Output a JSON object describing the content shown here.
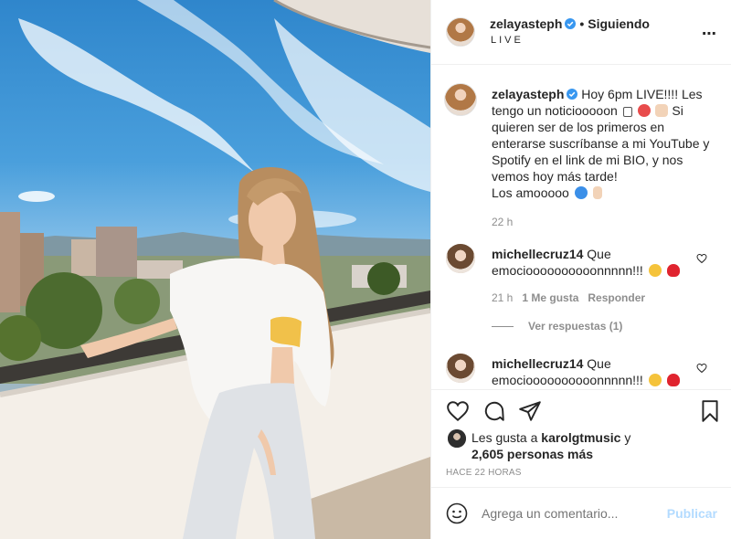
{
  "header": {
    "username": "zelayasteph",
    "separator": "•",
    "follow_status": "Siguiendo",
    "location": "LIVE",
    "more_icon": "⋯"
  },
  "caption": {
    "username": "zelayasteph",
    "text_lines": [
      "Hoy 6pm LIVE!!!! Les",
      "tengo un noticiooooon",
      "Si",
      "quieren ser de los primeros en",
      "enterarse suscríbanse a mi YouTube y",
      "Spotify en el link de mi BIO, y nos",
      "vemos hoy más tarde!",
      "Los amooooo"
    ],
    "time": "22 h"
  },
  "comments": [
    {
      "username": "michellecruz14",
      "text_a": "Que",
      "text_b": "emocioooooooooonnnnn!!!",
      "time": "21 h",
      "likes": "1 Me gusta",
      "reply": "Responder",
      "replies": "Ver respuestas (1)"
    },
    {
      "username": "michellecruz14",
      "text_a": "Que",
      "text_b": "emocioooooooooonnnnn!!!"
    }
  ],
  "likes": {
    "prefix": "Les gusta a",
    "user": "karolgtmusic",
    "conj": "y",
    "count": "2,605 personas más"
  },
  "timestamp": "HACE 22 HORAS",
  "composer": {
    "placeholder": "Agrega un comentario...",
    "post": "Publicar"
  },
  "icons": {
    "verified": "verified-badge-icon",
    "heart": "heart-icon",
    "comment": "comment-icon",
    "share": "share-icon",
    "save": "bookmark-icon",
    "emoji": "emoji-icon"
  },
  "colors": {
    "verified": "#3897f0",
    "post_disabled": "#b3dbff",
    "muted": "#8e8e8e",
    "text": "#262626"
  }
}
